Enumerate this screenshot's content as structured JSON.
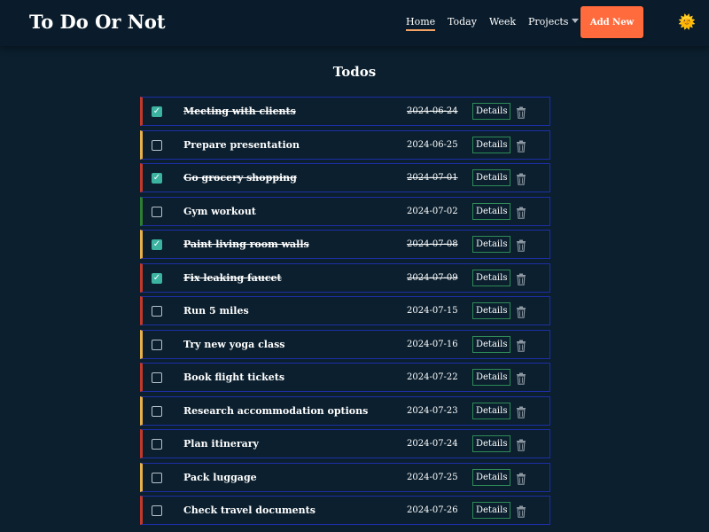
{
  "header": {
    "brand": "To Do Or Not",
    "nav": {
      "home": "Home",
      "today": "Today",
      "week": "Week",
      "projects": "Projects"
    },
    "add_button": "Add New",
    "theme_icon": "sun-icon",
    "theme_glyph": "🌞"
  },
  "main": {
    "title": "Todos",
    "details_label": "Details",
    "todos": [
      {
        "title": "Meeting with clients",
        "date": "2024-06-24",
        "done": true,
        "priority": "high"
      },
      {
        "title": "Prepare presentation",
        "date": "2024-06-25",
        "done": false,
        "priority": "medium"
      },
      {
        "title": "Go grocery shopping",
        "date": "2024-07-01",
        "done": true,
        "priority": "high"
      },
      {
        "title": "Gym workout",
        "date": "2024-07-02",
        "done": false,
        "priority": "low"
      },
      {
        "title": "Paint living room walls",
        "date": "2024-07-08",
        "done": true,
        "priority": "medium"
      },
      {
        "title": "Fix leaking faucet",
        "date": "2024-07-09",
        "done": true,
        "priority": "high"
      },
      {
        "title": "Run 5 miles",
        "date": "2024-07-15",
        "done": false,
        "priority": "high"
      },
      {
        "title": "Try new yoga class",
        "date": "2024-07-16",
        "done": false,
        "priority": "medium"
      },
      {
        "title": "Book flight tickets",
        "date": "2024-07-22",
        "done": false,
        "priority": "high"
      },
      {
        "title": "Research accommodation options",
        "date": "2024-07-23",
        "done": false,
        "priority": "medium"
      },
      {
        "title": "Plan itinerary",
        "date": "2024-07-24",
        "done": false,
        "priority": "high"
      },
      {
        "title": "Pack luggage",
        "date": "2024-07-25",
        "done": false,
        "priority": "medium"
      },
      {
        "title": "Check travel documents",
        "date": "2024-07-26",
        "done": false,
        "priority": "high"
      }
    ]
  },
  "colors": {
    "background": "#0b1f2e",
    "accent": "#ff6b3d",
    "priority_high": "#c0392b",
    "priority_medium": "#e8b04a",
    "priority_low": "#2e7d32",
    "row_border": "#1d2fa6",
    "checkbox_checked": "#3bb3a0",
    "details_border": "#2e8b57"
  }
}
